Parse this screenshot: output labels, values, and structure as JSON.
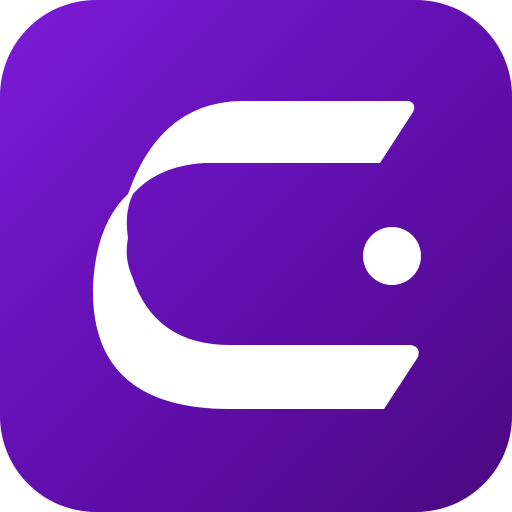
{
  "icon": {
    "name": "app-logo-icon",
    "glyph_name": "stylized-c-logo-icon",
    "dot_name": "logo-dot-icon",
    "colors": {
      "gradient_start": "#7A1BD6",
      "gradient_mid": "#620FB0",
      "gradient_end": "#4B0880",
      "mark": "#FFFFFF"
    }
  }
}
